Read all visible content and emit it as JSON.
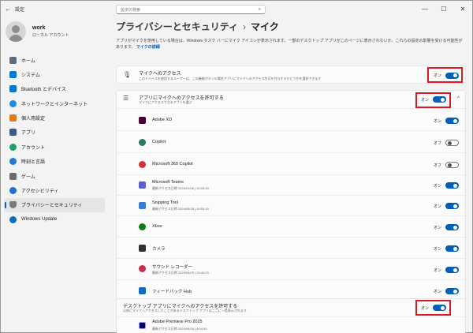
{
  "window": {
    "title": "設定",
    "back": "←",
    "controls": [
      "—",
      "☐",
      "✕"
    ]
  },
  "profile": {
    "name": "work",
    "account": "ローカル アカウント"
  },
  "search": {
    "placeholder": "設定の検索",
    "icon": "search-icon"
  },
  "sidebar": {
    "items": [
      {
        "label": "ホーム",
        "icon": "home-icon",
        "color": "#5f6b78",
        "active": false
      },
      {
        "label": "システム",
        "icon": "system-icon",
        "color": "#0078d4",
        "active": false
      },
      {
        "label": "Bluetooth とデバイス",
        "icon": "bluetooth-icon",
        "color": "#0078d4",
        "active": false
      },
      {
        "label": "ネットワークとインターネット",
        "icon": "network-icon",
        "color": "#1f8ae0",
        "active": false
      },
      {
        "label": "個人用設定",
        "icon": "brush-icon",
        "color": "#e07a1f",
        "active": false
      },
      {
        "label": "アプリ",
        "icon": "apps-icon",
        "color": "#3b5a8a",
        "active": false
      },
      {
        "label": "アカウント",
        "icon": "account-icon",
        "color": "#1fa063",
        "active": false
      },
      {
        "label": "時刻と言語",
        "icon": "time-language-icon",
        "color": "#1f7ad0",
        "active": false
      },
      {
        "label": "ゲーム",
        "icon": "game-icon",
        "color": "#6b6b6b",
        "active": false
      },
      {
        "label": "アクセシビリティ",
        "icon": "accessibility-icon",
        "color": "#1f6fd0",
        "active": false
      },
      {
        "label": "プライバシーとセキュリティ",
        "icon": "shield-icon",
        "color": "#7a7a7a",
        "active": true
      },
      {
        "label": "Windows Update",
        "icon": "update-icon",
        "color": "#0f6cbd",
        "active": false
      }
    ]
  },
  "header": {
    "parent": "プライバシーとセキュリティ",
    "separator": "›",
    "current": "マイク"
  },
  "description": {
    "text": "アプリがマイクを使用している場合は、Windows タスク バーにマイク アイコンが表示されます。一部のデスクトップ アプリがこのページに表示されないか、これらの設定の影響を受ける可能性があります。",
    "link": "マイクの詳細"
  },
  "mic_access": {
    "title": "マイクへのアクセス",
    "subtitle": "このデバイスを使用するユーザーは、この機能がオンの場合アプリにマイクへのアクセス許可を付与するかどうかを選択できます",
    "state": "オン",
    "on": true,
    "icon": "microphone-icon"
  },
  "apps_access": {
    "title": "アプリにマイクへのアクセスを許可する",
    "subtitle": "マイクにアクセスできるアプリを選ぶ",
    "state": "オン",
    "on": true,
    "icon": "list-icon",
    "chevron": "^"
  },
  "apps": [
    {
      "name": "Adobe XD",
      "sub": "",
      "state": "オン",
      "on": true,
      "icon": "adobe-xd-icon",
      "color": "#470137"
    },
    {
      "name": "Copilot",
      "sub": "",
      "state": "オフ",
      "on": false,
      "icon": "copilot-icon",
      "color": "#2b7a5a"
    },
    {
      "name": "Microsoft 365 Copilot",
      "sub": "",
      "state": "オフ",
      "on": false,
      "icon": "m365-copilot-icon",
      "color": "#d13438"
    },
    {
      "name": "Microsoft Teams",
      "sub": "最新アクセス日時 2025/01/08 | 15:53:43",
      "state": "オン",
      "on": true,
      "icon": "teams-icon",
      "color": "#5b5fc7"
    },
    {
      "name": "Snipping Tool",
      "sub": "最新アクセス日時 2024/09/28 | 18:53:19",
      "state": "オン",
      "on": true,
      "icon": "snipping-tool-icon",
      "color": "#3a7bd5"
    },
    {
      "name": "Xbox",
      "sub": "",
      "state": "オン",
      "on": true,
      "icon": "xbox-icon",
      "color": "#107c10"
    },
    {
      "name": "カメラ",
      "sub": "",
      "state": "オン",
      "on": true,
      "icon": "camera-icon",
      "color": "#2f2f2f"
    },
    {
      "name": "サウンド レコーダー",
      "sub": "最新アクセス日時 2025/08/25 | 23:40:03",
      "state": "オン",
      "on": true,
      "icon": "sound-recorder-icon",
      "color": "#c4314b"
    },
    {
      "name": "フィードバック Hub",
      "sub": "",
      "state": "オン",
      "on": true,
      "icon": "feedback-hub-icon",
      "color": "#0f6cbd"
    }
  ],
  "desktop_access": {
    "title": "デスクトップ アプリにマイクへのアクセスを許可する",
    "subtitle": "以前にマイクへアクセスしたことがあるデスクトップ アプリはここに一覧表示されます",
    "state": "オン",
    "on": true
  },
  "desktop_apps": [
    {
      "name": "Adobe Premiere Pro 2025",
      "sub": "最新アクセス日時 2025/08/26 | 8:04:50",
      "icon": "premiere-pro-icon",
      "color": "#00005b"
    }
  ],
  "colors": {
    "accent": "#005fb8",
    "highlight": "#d91a25"
  }
}
